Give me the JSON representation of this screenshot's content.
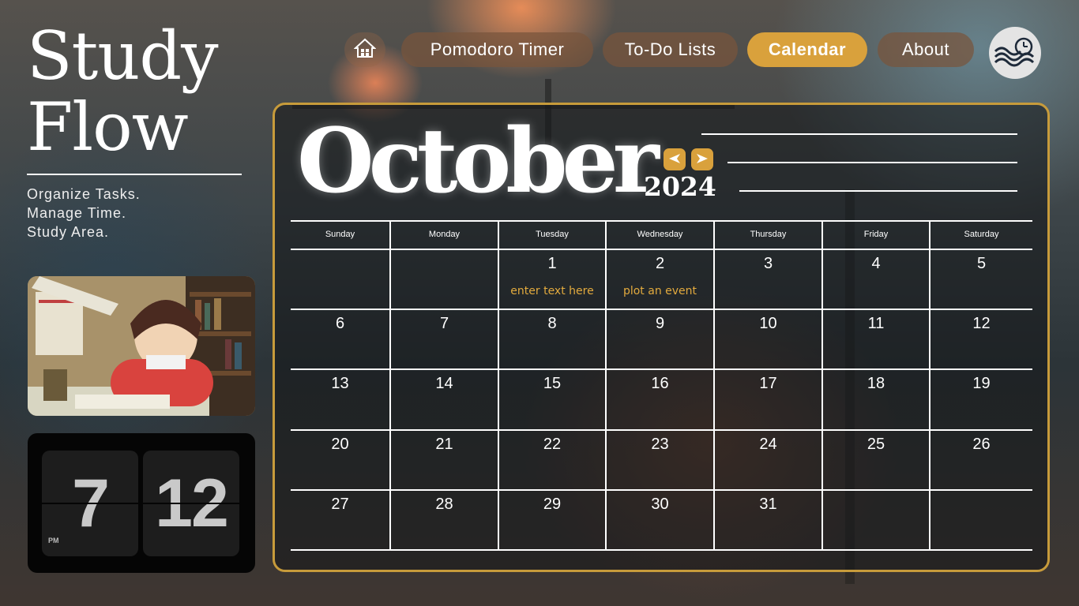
{
  "brand": {
    "title_line1": "Study",
    "title_line2": "Flow",
    "taglines": [
      "Organize Tasks.",
      "Manage Time.",
      "Study Area."
    ]
  },
  "nav": {
    "home_icon": "house-icon",
    "items": [
      {
        "label": "Pomodoro Timer",
        "active": false
      },
      {
        "label": "To-Do Lists",
        "active": false
      },
      {
        "label": "Calendar",
        "active": true
      },
      {
        "label": "About",
        "active": false
      }
    ],
    "logo_icon": "wave-clock-logo-icon"
  },
  "clock": {
    "hour": "7",
    "minute": "12",
    "period": "PM"
  },
  "calendar": {
    "month": "October",
    "year": "2024",
    "prev_icon": "arrow-left-icon",
    "next_icon": "arrow-right-icon",
    "weekdays": [
      "Sunday",
      "Monday",
      "Tuesday",
      "Wednesday",
      "Thursday",
      "Friday",
      "Saturday"
    ],
    "weeks": [
      [
        "",
        "",
        "1",
        "2",
        "3",
        "4",
        "5"
      ],
      [
        "6",
        "7",
        "8",
        "9",
        "10",
        "11",
        "12"
      ],
      [
        "13",
        "14",
        "15",
        "16",
        "17",
        "18",
        "19"
      ],
      [
        "20",
        "21",
        "22",
        "23",
        "24",
        "25",
        "26"
      ],
      [
        "27",
        "28",
        "29",
        "30",
        "31",
        "",
        ""
      ]
    ],
    "events": [
      {
        "day": "1",
        "text": "enter text here"
      },
      {
        "day": "2",
        "text": "plot an event"
      }
    ]
  },
  "colors": {
    "accent": "#d9a13c",
    "panel_border": "#c79b3b",
    "event_text": "#e3aa3e"
  }
}
